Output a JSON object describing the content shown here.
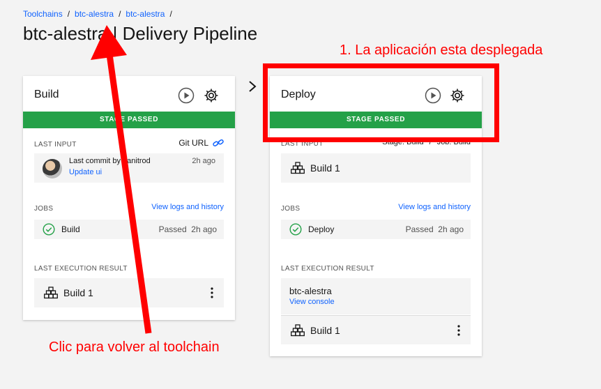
{
  "breadcrumb": {
    "items": [
      "Toolchains",
      "btc-alestra",
      "btc-alestra"
    ],
    "separator": "/"
  },
  "page": {
    "title": "btc-alestra | Delivery Pipeline"
  },
  "stages": {
    "build": {
      "title": "Build",
      "status": "STAGE PASSED",
      "last_input": {
        "label": "LAST INPUT",
        "source": "Git URL",
        "commit_text": "Last commit by danitrod",
        "commit_link": "Update ui",
        "time": "2h ago"
      },
      "jobs": {
        "label": "JOBS",
        "link": "View logs and history",
        "name": "Build",
        "status": "Passed",
        "time": "2h ago"
      },
      "last_result": {
        "label": "LAST EXECUTION RESULT",
        "build": "Build 1"
      }
    },
    "deploy": {
      "title": "Deploy",
      "status": "STAGE PASSED",
      "last_input": {
        "label": "LAST INPUT",
        "stage": "Stage: Build",
        "job": "Job: Build",
        "build": "Build 1"
      },
      "jobs": {
        "label": "JOBS",
        "link": "View logs and history",
        "name": "Deploy",
        "status": "Passed",
        "time": "2h ago"
      },
      "last_result": {
        "label": "LAST EXECUTION RESULT",
        "app": "btc-alestra",
        "console": "View console",
        "build": "Build 1"
      }
    }
  },
  "annotations": {
    "top": "1. La aplicación esta desplegada",
    "bottom": "Clic para volver al toolchain"
  },
  "colors": {
    "success": "#24a148",
    "link": "#0f62fe",
    "annotation": "#ff0000"
  },
  "icons": [
    "play-icon",
    "gear-icon",
    "link-icon",
    "check-circle-icon",
    "build-blocks-icon",
    "overflow-menu-icon",
    "chevron-right-icon"
  ]
}
